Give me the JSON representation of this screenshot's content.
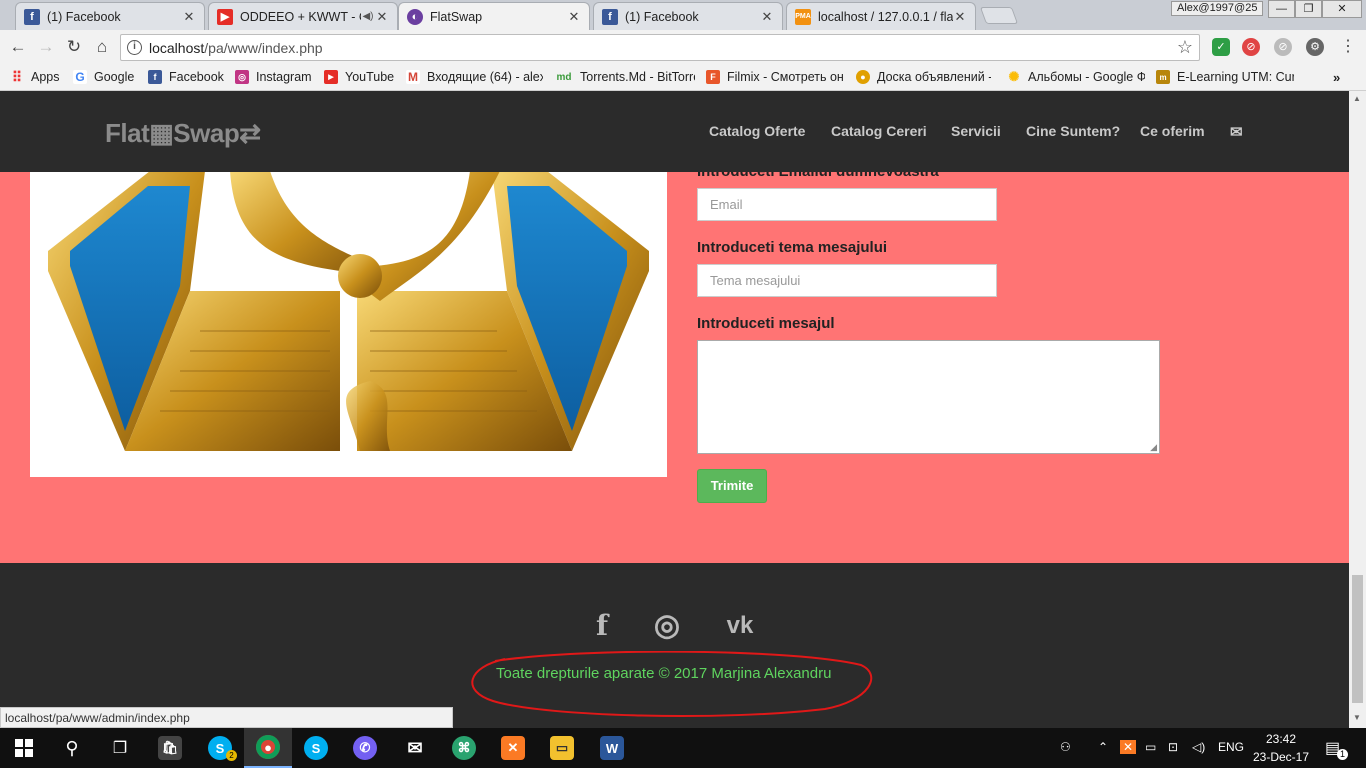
{
  "browser": {
    "profile_label": "Alex@1997@25",
    "tabs": [
      {
        "title": "(1) Facebook",
        "icon": "facebook-icon",
        "color": "#3b5998"
      },
      {
        "title": "ODDEEO + KWWT - C",
        "icon": "youtube-icon",
        "color": "#e52d27"
      },
      {
        "title": "FlatSwap",
        "icon": "flatswap-icon",
        "color": "#6b3fa0"
      },
      {
        "title": "(1) Facebook",
        "icon": "facebook-icon",
        "color": "#3b5998"
      },
      {
        "title": "localhost / 127.0.0.1 / fla",
        "icon": "phpmyadmin-icon",
        "color": "#f29111"
      }
    ],
    "url_host": "localhost",
    "url_path": "/pa/www/index.php",
    "bookmarks": [
      {
        "label": "Apps",
        "icon": "apps-icon",
        "color": "#e33"
      },
      {
        "label": "Google",
        "icon": "google-icon",
        "color": "#4285f4"
      },
      {
        "label": "Facebook",
        "icon": "facebook-icon",
        "color": "#3b5998"
      },
      {
        "label": "Instagram",
        "icon": "instagram-icon",
        "color": "#c13584"
      },
      {
        "label": "YouTube",
        "icon": "youtube-icon",
        "color": "#e52d27"
      },
      {
        "label": "Входящие (64) - alex",
        "icon": "gmail-icon",
        "color": "#d44638"
      },
      {
        "label": "Torrents.Md - BitTorre",
        "icon": "torrents-icon",
        "color": "#3a9a3a"
      },
      {
        "label": "Filmix - Смотреть он",
        "icon": "filmix-icon",
        "color": "#e8562a"
      },
      {
        "label": "Доска объявлений -",
        "icon": "ads-board-icon",
        "color": "#e0a000"
      },
      {
        "label": "Альбомы - Google Ф",
        "icon": "google-photos-icon",
        "color": "#fbbc05"
      },
      {
        "label": "E-Learning UTM: Curs",
        "icon": "elearning-icon",
        "color": "#b8860b"
      }
    ],
    "status_url": "localhost/pa/www/admin/index.php"
  },
  "site": {
    "logo": "Flat▦Swap⇄",
    "nav": [
      "Catalog Oferte",
      "Catalog Cereri",
      "Servicii",
      "Cine Suntem?",
      "Ce oferim"
    ],
    "form": {
      "email_label": "Introduceti Emailul dumnevoastra",
      "email_placeholder": "Email",
      "subject_label": "Introduceti tema mesajului",
      "subject_placeholder": "Tema mesajului",
      "message_label": "Introduceti mesajul",
      "submit_label": "Trimite"
    },
    "footer": {
      "copyright": "Toate drepturile aparate © 2017 Marjina Alexandru",
      "social": [
        {
          "label": "f",
          "icon": "facebook-icon"
        },
        {
          "label": "◎",
          "icon": "instagram-icon"
        },
        {
          "label": "vk",
          "icon": "vk-icon"
        }
      ]
    }
  },
  "taskbar": {
    "skype_badge": "2",
    "language": "ENG",
    "time": "23:42",
    "date": "23-Dec-17",
    "notification_count": "1"
  }
}
